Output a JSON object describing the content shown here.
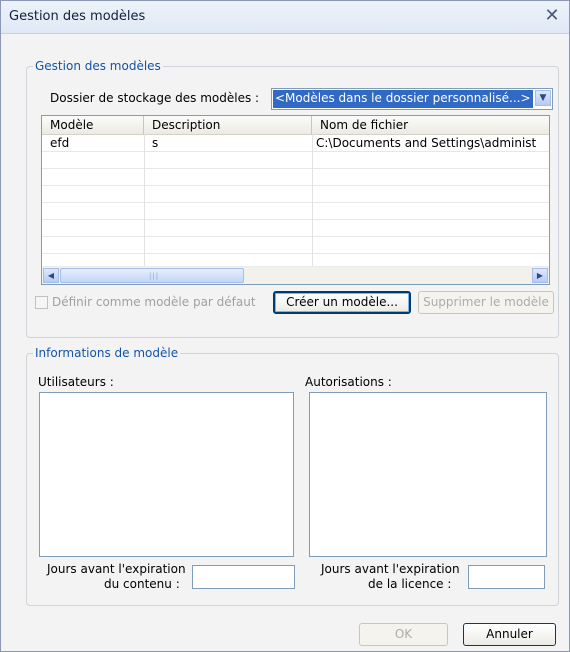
{
  "window": {
    "title": "Gestion des modèles"
  },
  "management_group": {
    "legend": "Gestion des modèles",
    "storage_label": "Dossier de stockage des modèles :",
    "storage_value": "<Modèles dans le dossier personnalisé...>",
    "columns": [
      "Modèle",
      "Description",
      "Nom de fichier"
    ],
    "rows": [
      {
        "model": "efd",
        "description": "s",
        "filename": "C:\\Documents and Settings\\administ"
      }
    ],
    "default_checkbox_label": "Définir comme modèle par défaut",
    "create_button": "Créer un modèle...",
    "delete_button": "Supprimer le modèle"
  },
  "info_group": {
    "legend": "Informations de modèle",
    "users_label": "Utilisateurs :",
    "permissions_label": "Autorisations :",
    "content_expiry_label_1": "Jours avant l'expiration",
    "content_expiry_label_2": "du contenu :",
    "license_expiry_label_1": "Jours avant l'expiration",
    "license_expiry_label_2": "de la licence :"
  },
  "footer": {
    "ok_button": "OK",
    "cancel_button": "Annuler"
  },
  "icons": {
    "close": "close-icon",
    "dropdown": "chevron-down-icon",
    "scroll_left": "arrow-left-icon",
    "scroll_right": "arrow-right-icon"
  },
  "colors": {
    "legend": "#1553a6",
    "selection": "#316ac5"
  }
}
